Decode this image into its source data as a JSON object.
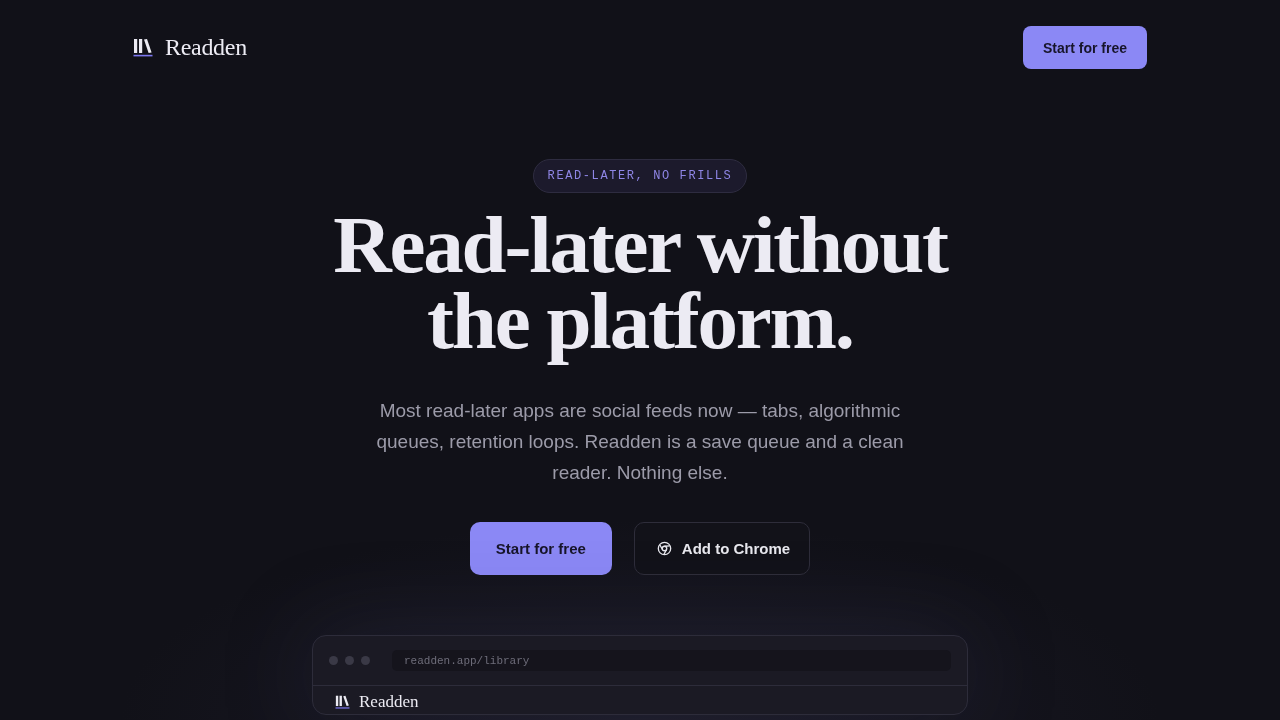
{
  "nav": {
    "logo": "Readden",
    "cta": "Start for free"
  },
  "hero": {
    "badge": "READ-LATER, NO FRILLS",
    "headline": "Read-later without\nthe platform.",
    "description": "Most read-later apps are social feeds now — tabs, algorithmic queues, retention loops. Readden is a save queue and a clean reader. Nothing else.",
    "buttons": [
      {
        "label": "Start for free",
        "kind": "primary"
      },
      {
        "label": "Add to Chrome",
        "kind": "secondary"
      }
    ]
  },
  "preview": {
    "url": "readden.app/library",
    "logo": "Readden"
  }
}
